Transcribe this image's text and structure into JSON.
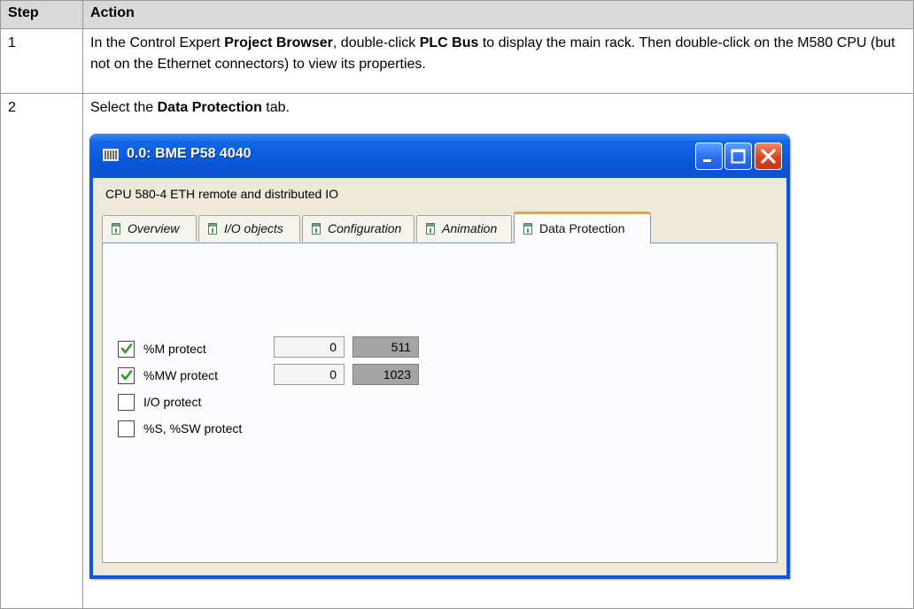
{
  "table": {
    "headers": {
      "step": "Step",
      "action": "Action"
    },
    "rows": [
      {
        "step": "1",
        "segments": [
          {
            "text": "In the Control Expert ",
            "bold": false
          },
          {
            "text": "Project Browser",
            "bold": true
          },
          {
            "text": ", double-click ",
            "bold": false
          },
          {
            "text": "PLC Bus",
            "bold": true
          },
          {
            "text": " to display the main rack. Then double-click on the M580 CPU (but not on the Ethernet connectors) to view its properties.",
            "bold": false
          }
        ]
      },
      {
        "step": "2",
        "segments": [
          {
            "text": "Select the ",
            "bold": false
          },
          {
            "text": "Data Protection",
            "bold": true
          },
          {
            "text": " tab.",
            "bold": false
          }
        ]
      }
    ]
  },
  "window": {
    "title": "0.0: BME P58 4040",
    "title_icon": "rack-icon",
    "controls": [
      "minimize-icon",
      "maximize-icon",
      "close-icon"
    ],
    "cpu_description": "CPU 580-4 ETH remote and distributed IO",
    "tabs": [
      {
        "label": "Overview",
        "active": false
      },
      {
        "label": "I/O objects",
        "active": false
      },
      {
        "label": "Configuration",
        "active": false
      },
      {
        "label": "Animation",
        "active": false
      },
      {
        "label": "Data Protection",
        "active": true
      }
    ],
    "options": [
      {
        "label": "%M protect",
        "checked": true,
        "start": "0",
        "end": "511"
      },
      {
        "label": "%MW protect",
        "checked": true,
        "start": "0",
        "end": "1023"
      },
      {
        "label": "I/O protect",
        "checked": false
      },
      {
        "label": "%S, %SW protect",
        "checked": false
      }
    ]
  },
  "colors": {
    "titlebar": "#0b58d9",
    "client": "#ece9d8",
    "active_tab_accent": "#e8a33a",
    "close_button": "#d9451e",
    "check": "#2a9a2a"
  }
}
